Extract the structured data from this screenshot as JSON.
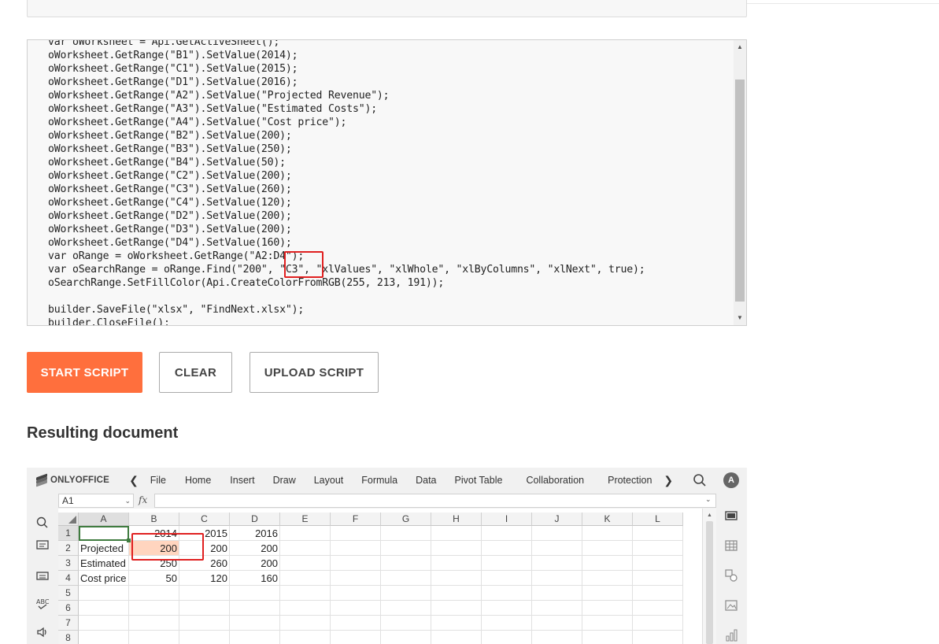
{
  "code_lines": [
    "var oWorksheet = Api.GetActiveSheet();",
    "oWorksheet.GetRange(\"B1\").SetValue(2014);",
    "oWorksheet.GetRange(\"C1\").SetValue(2015);",
    "oWorksheet.GetRange(\"D1\").SetValue(2016);",
    "oWorksheet.GetRange(\"A2\").SetValue(\"Projected Revenue\");",
    "oWorksheet.GetRange(\"A3\").SetValue(\"Estimated Costs\");",
    "oWorksheet.GetRange(\"A4\").SetValue(\"Cost price\");",
    "oWorksheet.GetRange(\"B2\").SetValue(200);",
    "oWorksheet.GetRange(\"B3\").SetValue(250);",
    "oWorksheet.GetRange(\"B4\").SetValue(50);",
    "oWorksheet.GetRange(\"C2\").SetValue(200);",
    "oWorksheet.GetRange(\"C3\").SetValue(260);",
    "oWorksheet.GetRange(\"C4\").SetValue(120);",
    "oWorksheet.GetRange(\"D2\").SetValue(200);",
    "oWorksheet.GetRange(\"D3\").SetValue(200);",
    "oWorksheet.GetRange(\"D4\").SetValue(160);",
    "var oRange = oWorksheet.GetRange(\"A2:D4\");",
    "var oSearchRange = oRange.Find(\"200\", \"C3\", \"xlValues\", \"xlWhole\", \"xlByColumns\", \"xlNext\", true);",
    "oSearchRange.SetFillColor(Api.CreateColorFromRGB(255, 213, 191));",
    "",
    "builder.SaveFile(\"xlsx\", \"FindNext.xlsx\");",
    "builder.CloseFile();"
  ],
  "buttons": {
    "start": "START SCRIPT",
    "clear": "CLEAR",
    "upload": "UPLOAD SCRIPT"
  },
  "section_title": "Resulting document",
  "editor_app": {
    "logo": "ONLYOFFICE",
    "tabs": [
      "File",
      "Home",
      "Insert",
      "Draw",
      "Layout",
      "Formula",
      "Data",
      "Pivot Table",
      "Collaboration",
      "Protection"
    ],
    "avatar_initial": "A",
    "name_box": "A1",
    "fx_label": "fx"
  },
  "sheet": {
    "columns": [
      "A",
      "B",
      "C",
      "D",
      "E",
      "F",
      "G",
      "H",
      "I",
      "J",
      "K",
      "L"
    ],
    "rows": [
      "1",
      "2",
      "3",
      "4",
      "5",
      "6",
      "7",
      "8"
    ],
    "cells": [
      [
        "",
        "2014",
        "2015",
        "2016"
      ],
      [
        "Projected",
        "200",
        "200",
        "200"
      ],
      [
        "Estimated",
        "250",
        "260",
        "200"
      ],
      [
        "Cost price",
        "50",
        "120",
        "160"
      ]
    ],
    "fill_color": "#ffd5bf",
    "accent_color": "#ff6f3d"
  }
}
